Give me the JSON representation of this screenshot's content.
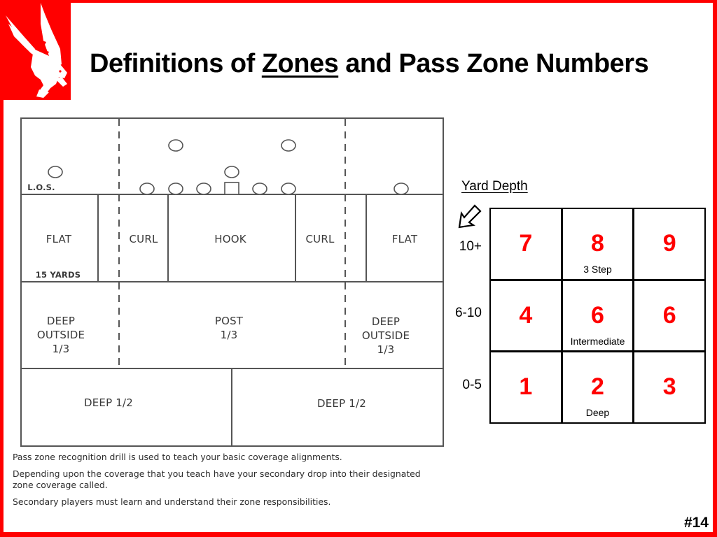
{
  "slide": {
    "title_before": "Definitions of ",
    "title_underlined": "Zones",
    "title_after": " and Pass Zone Numbers",
    "page_number": "#14",
    "logo": "falcon-logo",
    "accent_color": "#ff0000"
  },
  "diagram": {
    "los_label": "L.O.S.",
    "yards_label": "15 YARDS",
    "underneath_zones": [
      "FLAT",
      "CURL",
      "HOOK",
      "CURL",
      "FLAT"
    ],
    "thirds_zones": [
      {
        "line1": "DEEP",
        "line2": "OUTSIDE",
        "line3": "1/3"
      },
      {
        "line1": "POST",
        "line2": "1/3"
      },
      {
        "line1": "DEEP",
        "line2": "OUTSIDE",
        "line3": "1/3"
      }
    ],
    "halves_zones": [
      "DEEP 1/2",
      "DEEP 1/2"
    ]
  },
  "notes": [
    "Pass zone recognition drill is used to teach your basic coverage alignments.",
    "Depending upon the coverage that you teach have your secondary drop into their designated zone coverage called.",
    "Secondary players must learn and understand their zone responsibilities."
  ],
  "yard_depth": {
    "title": "Yard Depth",
    "arrow_icon": "arrow-down-left-icon",
    "row_labels": [
      "10+",
      "6-10",
      "0-5"
    ],
    "grid": [
      [
        {
          "num": "7",
          "sub": ""
        },
        {
          "num": "8",
          "sub": "3 Step"
        },
        {
          "num": "9",
          "sub": ""
        }
      ],
      [
        {
          "num": "4",
          "sub": ""
        },
        {
          "num": "6",
          "sub": "Intermediate"
        },
        {
          "num": "6",
          "sub": ""
        }
      ],
      [
        {
          "num": "1",
          "sub": ""
        },
        {
          "num": "2",
          "sub": "Deep"
        },
        {
          "num": "3",
          "sub": ""
        }
      ]
    ]
  }
}
